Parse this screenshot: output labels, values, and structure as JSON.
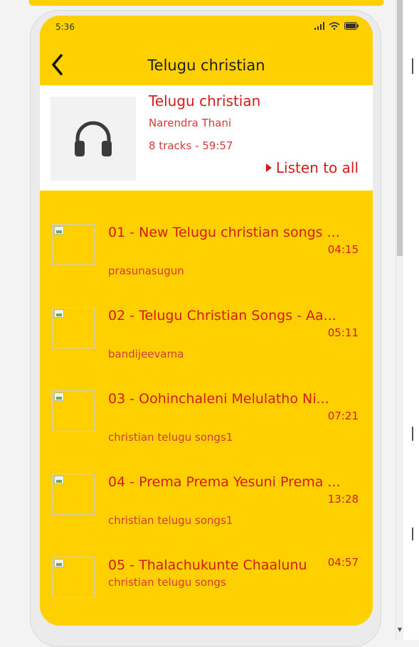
{
  "status": {
    "time": "5:36"
  },
  "header": {
    "title": "Telugu christian",
    "back_icon": "back-chevron-icon"
  },
  "playlist": {
    "title": "Telugu christian",
    "artist": "Narendra Thani",
    "meta": "8 tracks - 59:57",
    "listen_label": "Listen to all",
    "cover_icon": "headphones-icon"
  },
  "tracks": [
    {
      "title": "01 - New Telugu christian songs ...",
      "duration": "04:15",
      "artist": "prasunasugun"
    },
    {
      "title": "02 - Telugu Christian Songs - Aa...",
      "duration": "05:11",
      "artist": "bandijeevama"
    },
    {
      "title": "03 - Oohinchaleni Melulatho Ni...",
      "duration": "07:21",
      "artist": "christian telugu songs1"
    },
    {
      "title": "04 - Prema Prema Yesuni Prema ...",
      "duration": "13:28",
      "artist": "christian telugu songs1"
    },
    {
      "title": "05 - Thalachukunte Chaalunu",
      "duration": "04:57",
      "artist": "christian telugu songs"
    }
  ],
  "colors": {
    "accent": "#ffd000",
    "text_red": "#d51a1a",
    "card": "#ffffff"
  }
}
